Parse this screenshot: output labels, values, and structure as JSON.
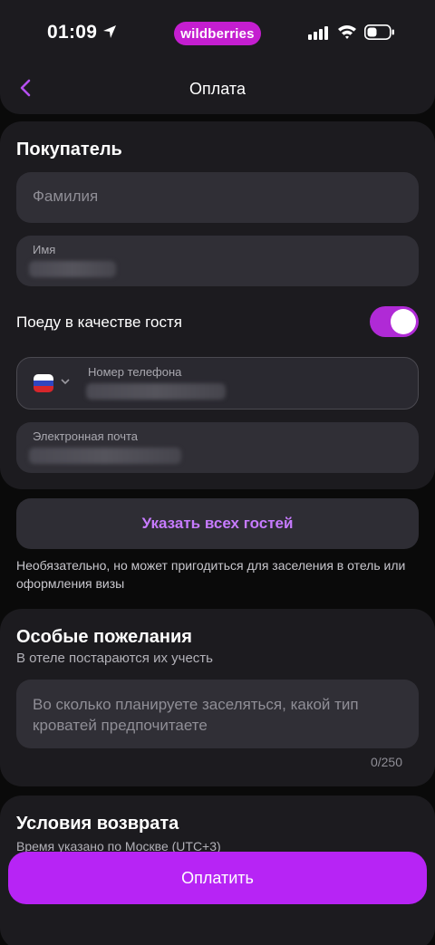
{
  "status_bar": {
    "time": "01:09",
    "brand": "wildberries"
  },
  "header": {
    "title": "Оплата"
  },
  "buyer": {
    "title": "Покупатель",
    "surname_placeholder": "Фамилия",
    "name_label": "Имя",
    "guest_toggle_label": "Поеду в качестве гостя",
    "guest_toggle_on": true,
    "phone_label": "Номер телефона",
    "email_label": "Электронная почта"
  },
  "guests": {
    "button_label": "Указать всех гостей",
    "hint": "Необязательно, но может пригодиться для заселения в отель или оформления визы"
  },
  "wishes": {
    "title": "Особые пожелания",
    "subtitle": "В отеле постараются их учесть",
    "placeholder": "Во сколько планируете заселяться, какой тип кроватей предпочитаете",
    "counter": "0/250"
  },
  "refund": {
    "title": "Условия возврата",
    "subtitle": "Время указано по Москве (UTC+3)"
  },
  "pay_button": {
    "label": "Оплатить"
  },
  "colors": {
    "accent": "#b724f5",
    "accent_text": "#c77bff",
    "card_bg": "#1c1b1f",
    "field_bg": "#302f36"
  }
}
